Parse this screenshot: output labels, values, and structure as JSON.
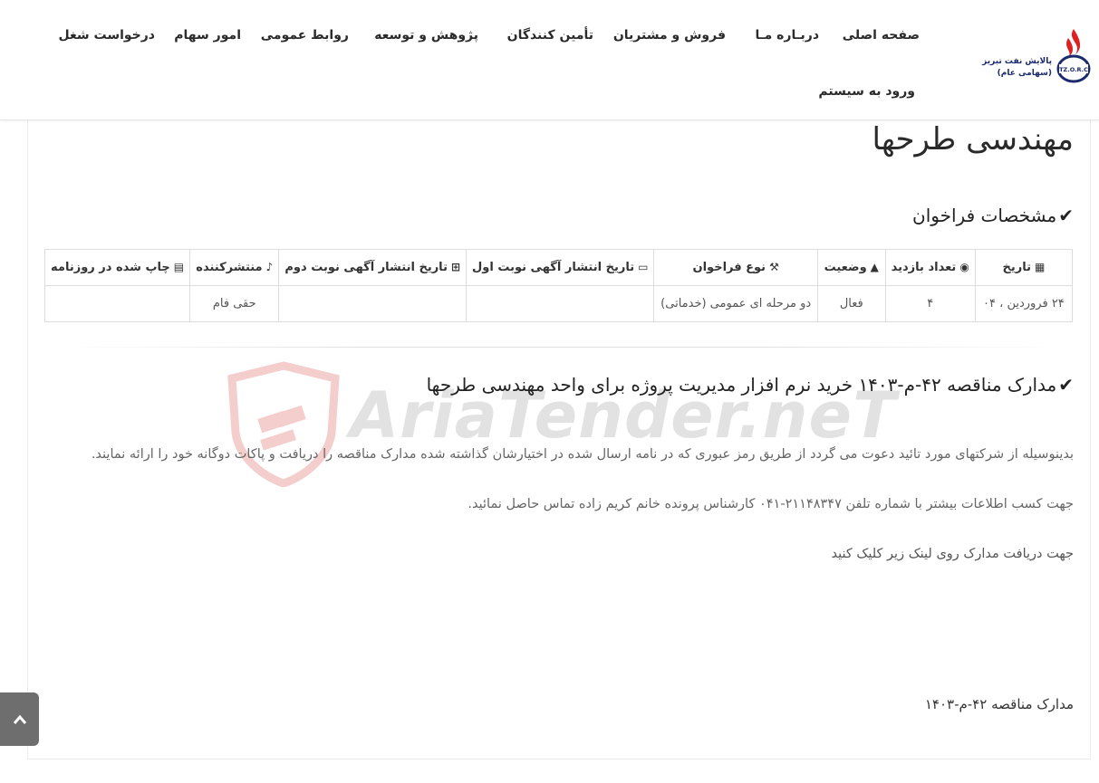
{
  "brand": {
    "name_line1": "پالایش نفت تبریز",
    "name_line2": "(سهامی عام)",
    "abbr": "TZ.O.R.C"
  },
  "nav": {
    "home": "صفحه اصلی",
    "about": "دربـاره مـا",
    "sales": "فروش و مشتریان",
    "suppliers": "تأمین کنندگان",
    "research": "پژوهش و توسعه",
    "pr": "روابط عمومی",
    "shares": "امور سهام",
    "jobs": "درخواست شغل",
    "login": "ورود به سیستم"
  },
  "page": {
    "title": "مهندسی طرحها",
    "spec_title": "مشخصات فراخوان",
    "tender_title": "مدارک مناقصه ۴۲-م-۱۴۰۳ خرید نرم افزار مدیریت پروژه برای واحد مهندسی طرحها",
    "para1": "بدینوسیله از شرکتهای مورد تائید دعوت می گردد از طریق رمز عبوری که در نامه ارسال شده در اختیارشان گذاشته شده مدارک مناقصه را دریافت و پاکات دوگانه خود را ارائه نمایند.",
    "para2": "جهت کسب اطلاعات بیشتر با شماره تلفن ۲۱۱۴۸۳۴۷-۰۴۱ کارشناس پرونده خانم کریم زاده تماس حاصل نمائید.",
    "para3": "جهت دریافت مدارک روی لینک زیر کلیک کنید",
    "doc_link": "مدارک مناقصه ۴۲-م-۱۴۰۳"
  },
  "table": {
    "headers": {
      "date": "تاریخ",
      "visits": "تعداد بازدید",
      "status": "وضعیت",
      "type": "نوع فراخوان",
      "pub1": "تاریخ انتشار آگهی نوبت اول",
      "pub2": "تاریخ انتشار آگهی نوبت دوم",
      "publisher": "منتشرکننده",
      "newspaper": "چاپ شده در روزنامه"
    },
    "row": {
      "date": "۲۴ فروردین ، ۰۴",
      "visits": "۴",
      "status": "فعال",
      "type": "دو مرحله ای عمومی (خدماتی)",
      "pub1": "",
      "pub2": "",
      "publisher": "حقی فام",
      "newspaper": ""
    }
  },
  "watermark": "AriaTender.neT",
  "colors": {
    "logo_red": "#e02020",
    "logo_blue": "#1a2a6c",
    "watermark_red": "#d9534f"
  },
  "icons": [
    "calendar-icon",
    "eye-icon",
    "warning-icon",
    "gavel-icon",
    "calendar-plus-icon",
    "bell-icon",
    "newspaper-icon",
    "check-icon",
    "chevron-up-icon"
  ]
}
